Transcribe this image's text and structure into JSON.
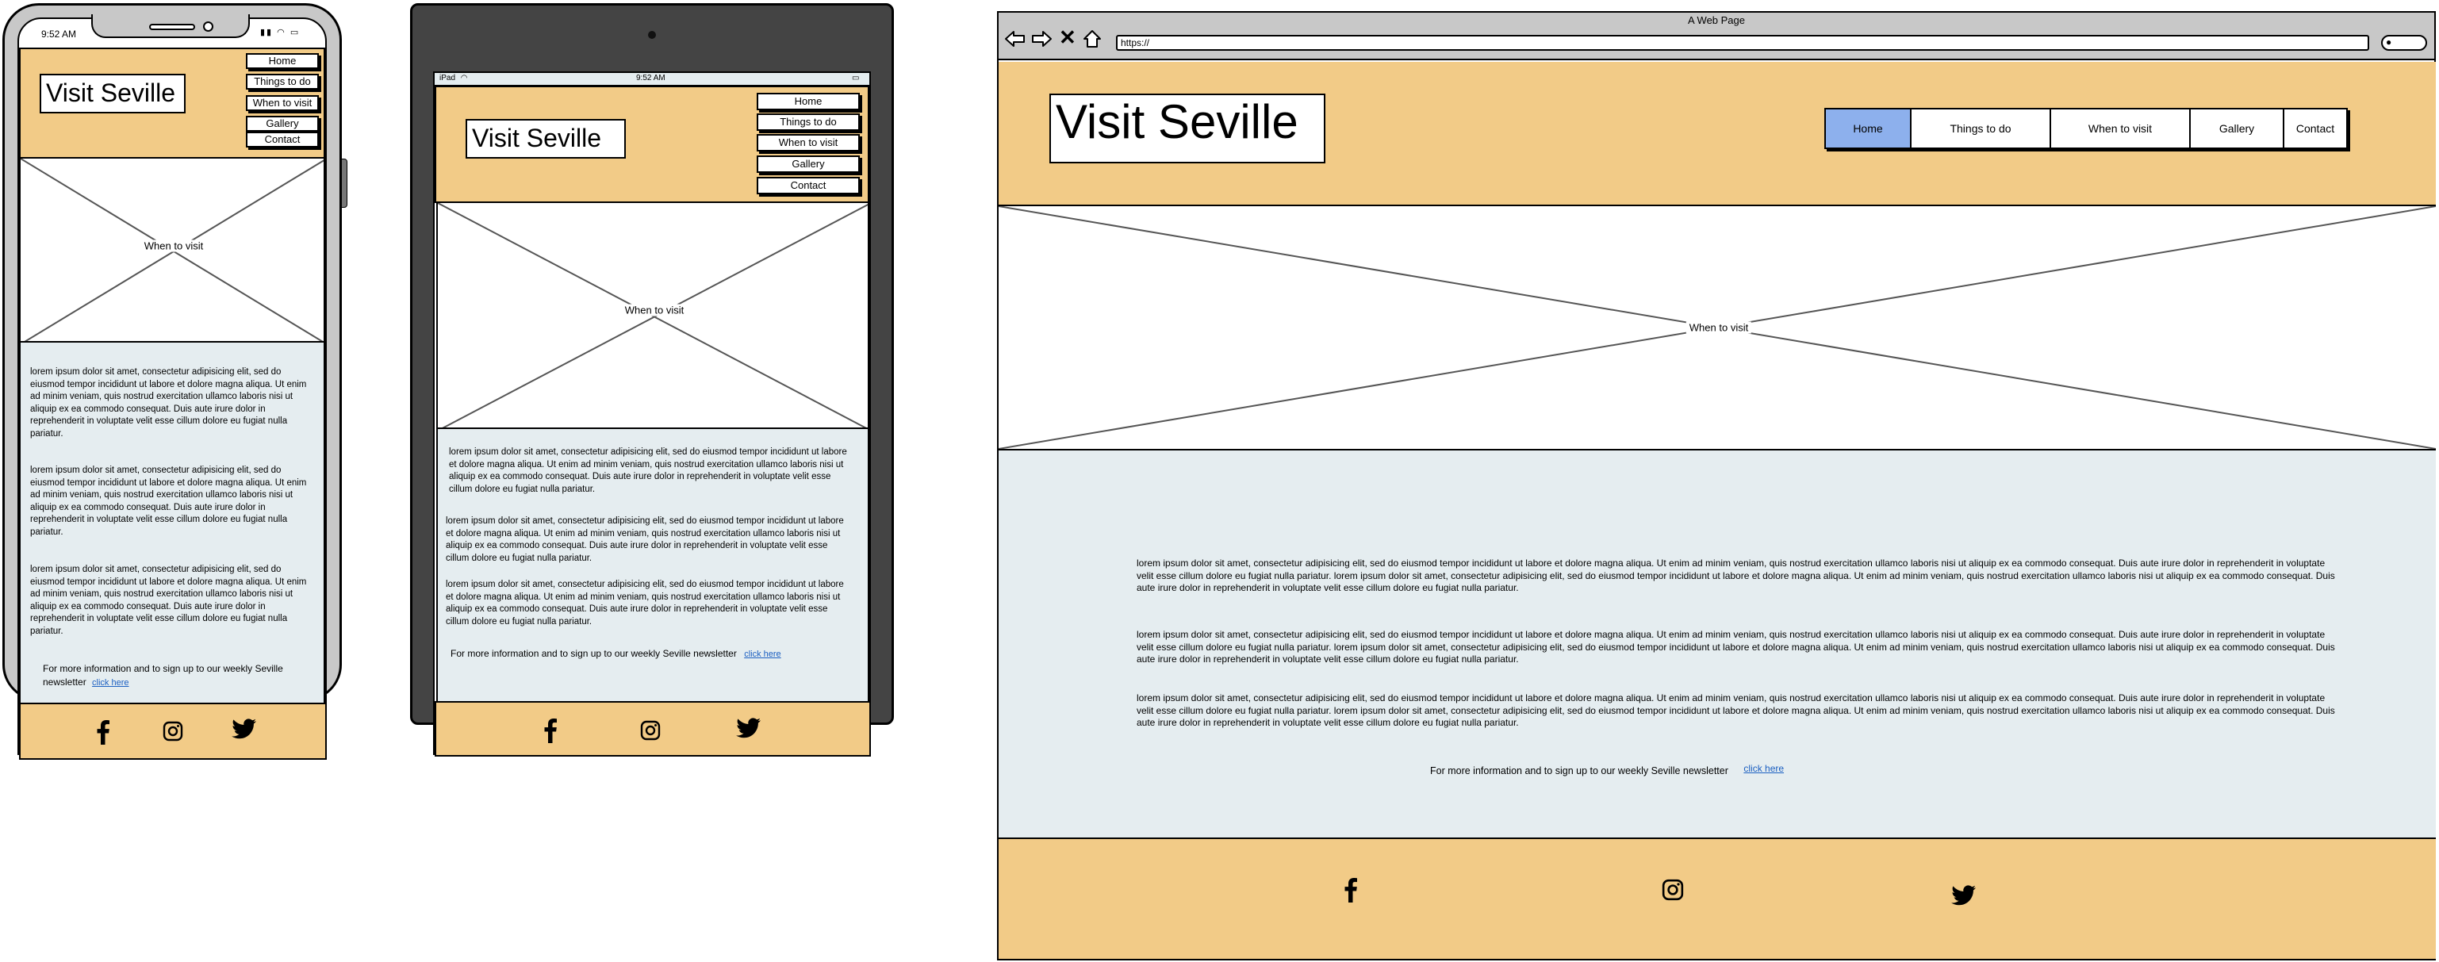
{
  "site": {
    "title": "Visit Seville",
    "nav": [
      "Home",
      "Things to do",
      "When to visit",
      "Gallery",
      "Contact"
    ],
    "hero_label": "When to visit",
    "paragraph": "lorem ipsum dolor sit amet, consectetur adipisicing elit, sed do eiusmod tempor incididunt ut labore et dolore magna aliqua. Ut enim ad minim veniam, quis nostrud exercitation ullamco laboris nisi ut aliquip ex ea commodo consequat. Duis aute irure dolor in reprehenderit in voluptate velit esse cillum dolore eu fugiat nulla pariatur.",
    "desktop_paragraph": "lorem ipsum dolor sit amet, consectetur adipisicing elit, sed do eiusmod tempor incididunt ut labore et dolore magna aliqua. Ut enim ad minim veniam, quis nostrud exercitation ullamco laboris nisi ut aliquip ex ea commodo consequat. Duis aute irure dolor in reprehenderit in voluptate velit esse cillum dolore eu fugiat nulla pariatur. lorem ipsum dolor sit amet, consectetur adipisicing elit, sed do eiusmod tempor incididunt ut labore et dolore magna aliqua. Ut enim ad minim veniam, quis nostrud exercitation ullamco laboris nisi ut aliquip ex ea commodo consequat. Duis aute irure dolor in reprehenderit in voluptate velit esse cillum dolore eu fugiat nulla pariatur.",
    "newsletter_text": "For more information and to sign up to our weekly Seville newsletter",
    "newsletter_link": "click here",
    "social_icons": [
      "facebook-icon",
      "instagram-icon",
      "twitter-icon"
    ]
  },
  "phone": {
    "time": "9:52 AM"
  },
  "tablet": {
    "device_label": "iPad",
    "time": "9:52 AM"
  },
  "browser": {
    "window_title": "A Web Page",
    "url": "https://",
    "active_nav": "Home"
  },
  "colors": {
    "header_bg": "#f2cb87",
    "content_bg": "#e5edf0",
    "nav_active": "#8db0ed",
    "device_dark": "#444444",
    "device_light": "#c8c8c8",
    "link": "#1b5fc1"
  }
}
